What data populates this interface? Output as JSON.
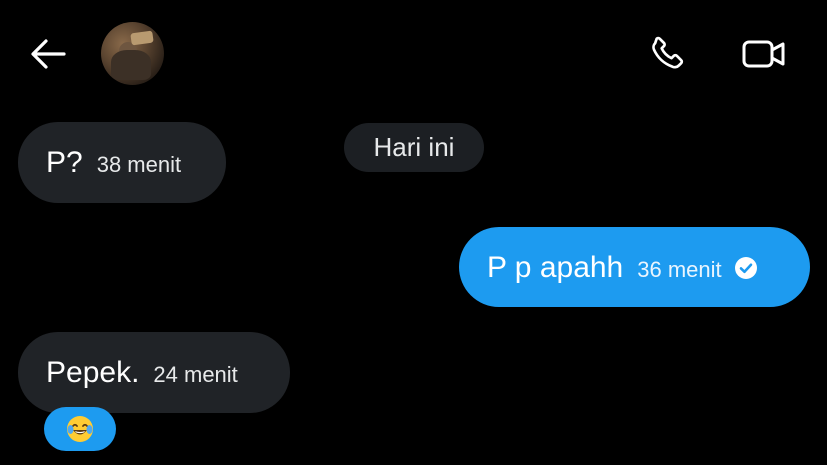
{
  "header": {
    "back_icon": "arrow-left-icon",
    "avatar": "contact-avatar",
    "call_icon": "phone-icon",
    "video_icon": "video-camera-icon"
  },
  "conversation": {
    "date_separator": "Hari ini",
    "messages": [
      {
        "direction": "incoming",
        "text": "P?",
        "time": "38 menit"
      },
      {
        "direction": "outgoing",
        "text": "P p apahh",
        "time": "36 menit",
        "status_icon": "read-check-icon"
      },
      {
        "direction": "incoming",
        "text": "Pepek.",
        "time": "24 menit"
      }
    ],
    "reaction": {
      "emoji": "😂",
      "on_message": 3
    }
  },
  "colors": {
    "background": "#000000",
    "incoming_bubble": "#202327",
    "outgoing_bubble": "#1d9bf0",
    "date_pill": "#1c1f23",
    "text": "#ffffff"
  }
}
